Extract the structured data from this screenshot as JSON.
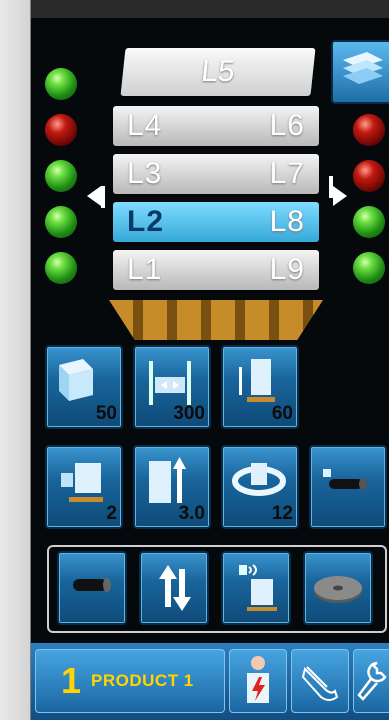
{
  "pallet": {
    "top_layer": "L5",
    "rows": [
      {
        "left": "L4",
        "right": "L6",
        "selected": false
      },
      {
        "left": "L3",
        "right": "L7",
        "selected": false
      },
      {
        "left": "L2",
        "right": "L8",
        "selected": true
      },
      {
        "left": "L1",
        "right": "L9",
        "selected": false
      }
    ]
  },
  "leds_left": [
    "green",
    "red",
    "green",
    "green",
    "green"
  ],
  "leds_right": [
    "red",
    "red",
    "green",
    "green"
  ],
  "tiles_row1": [
    {
      "icon": "unload-box-icon",
      "value": "50"
    },
    {
      "icon": "spacing-icon",
      "value": "300"
    },
    {
      "icon": "stack-height-icon",
      "value": "60"
    }
  ],
  "tiles_row2": [
    {
      "icon": "pallet-feed-icon",
      "value": "2"
    },
    {
      "icon": "lift-height-icon",
      "value": "3.0"
    },
    {
      "icon": "rotate-wrap-icon",
      "value": "12"
    },
    {
      "icon": "conveyor-roller-icon",
      "value": ""
    }
  ],
  "panel_buttons": [
    "roller-icon",
    "up-down-arrows-icon",
    "sensor-box-icon",
    "turntable-icon"
  ],
  "bottom_bar": {
    "product_number": "1",
    "product_label": "PRODUCT 1",
    "buttons": [
      "operator-alert-icon",
      "hand-settings-icon",
      "wrench-icon"
    ]
  },
  "colors": {
    "accent": "#1f6ea8",
    "product_text": "#ffd400",
    "selected_layer": "#36a9d8"
  }
}
